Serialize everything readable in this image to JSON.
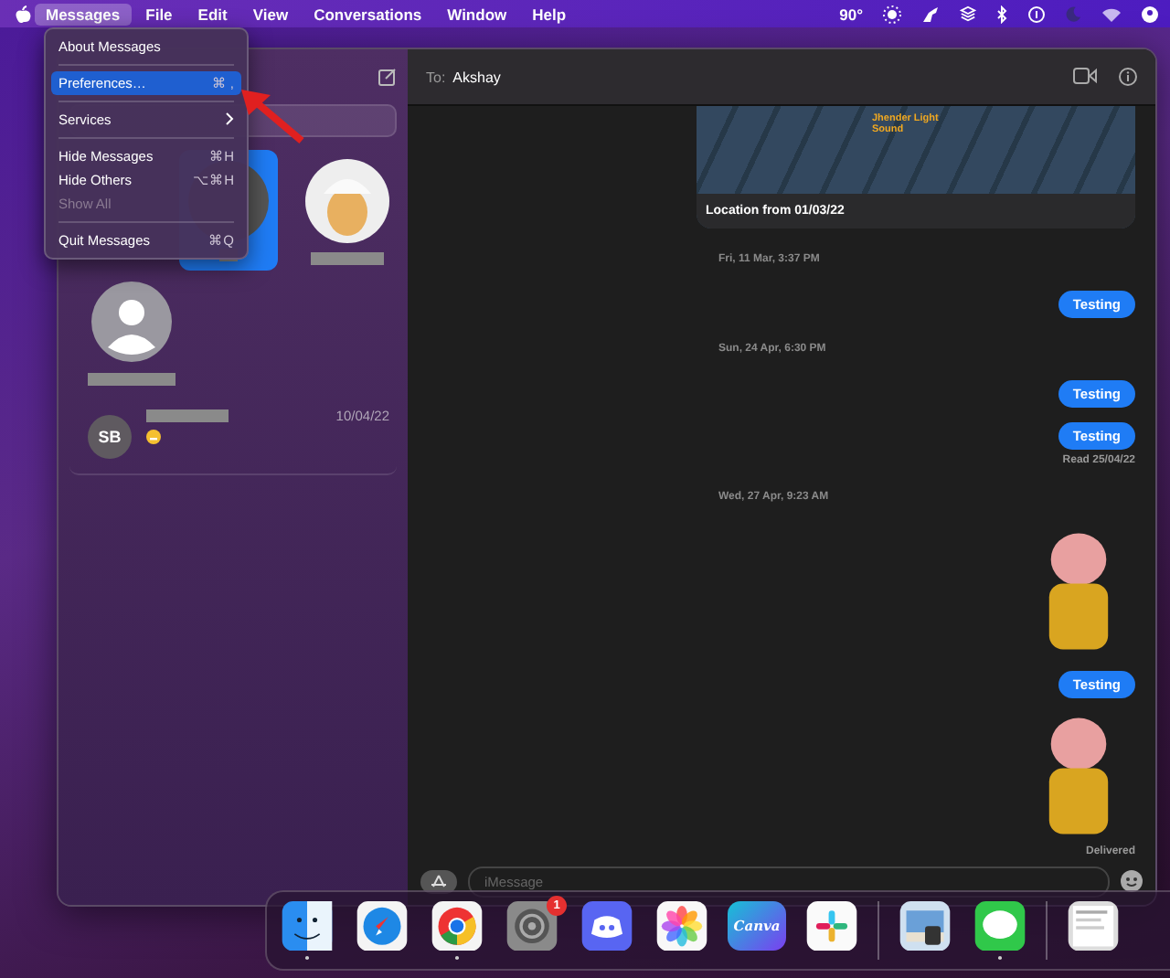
{
  "menu_bar": {
    "items": [
      {
        "label": "Messages",
        "selected": true
      },
      {
        "label": "File",
        "selected": false
      },
      {
        "label": "Edit",
        "selected": false
      },
      {
        "label": "View",
        "selected": false
      },
      {
        "label": "Conversations",
        "selected": false
      },
      {
        "label": "Window",
        "selected": false
      },
      {
        "label": "Help",
        "selected": false
      }
    ],
    "temperature": "90°"
  },
  "menu": {
    "items": [
      {
        "kind": "item",
        "label": "About Messages",
        "selected": false,
        "disabled": false
      },
      {
        "kind": "separator"
      },
      {
        "kind": "item",
        "label": "Preferences…",
        "shortcut": "⌘ ,",
        "selected": true,
        "disabled": false
      },
      {
        "kind": "separator"
      },
      {
        "kind": "submenu",
        "label": "Services",
        "selected": false,
        "disabled": false
      },
      {
        "kind": "separator"
      },
      {
        "kind": "item",
        "label": "Hide Messages",
        "shortcut": "⌘H",
        "selected": false,
        "disabled": false
      },
      {
        "kind": "item",
        "label": "Hide Others",
        "shortcut": "⌥⌘H",
        "selected": false,
        "disabled": false
      },
      {
        "kind": "item",
        "label": "Show All",
        "selected": false,
        "disabled": true
      },
      {
        "kind": "separator"
      },
      {
        "kind": "item",
        "label": "Quit Messages",
        "shortcut": "⌘Q",
        "selected": false,
        "disabled": false
      }
    ]
  },
  "sidebar": {
    "pinned": [
      {
        "kind": "photo",
        "selected": true
      },
      {
        "kind": "memoji",
        "selected": false
      }
    ],
    "contacts": [
      {
        "kind": "avatar"
      }
    ],
    "conversations": [
      {
        "initials": "SB",
        "date": "10/04/22",
        "selected": false
      }
    ]
  },
  "chat": {
    "to_label": "To:",
    "recipient": "Akshay",
    "messages": [
      {
        "kind": "location",
        "caption": "Location from 01/03/22",
        "place": "Jhender Light Sound"
      },
      {
        "kind": "timestamp",
        "text": "Fri, 11 Mar, 3:37 PM"
      },
      {
        "kind": "bubble",
        "text": "Testing"
      },
      {
        "kind": "timestamp",
        "text": "Sun, 24 Apr, 6:30 PM"
      },
      {
        "kind": "bubble",
        "text": "Testing"
      },
      {
        "kind": "bubble",
        "text": "Testing"
      },
      {
        "kind": "receipt",
        "text": "Read 25/04/22"
      },
      {
        "kind": "timestamp",
        "text": "Wed, 27 Apr, 9:23 AM"
      },
      {
        "kind": "sticker"
      },
      {
        "kind": "bubble",
        "text": "Testing"
      },
      {
        "kind": "sticker"
      },
      {
        "kind": "receipt",
        "text": "Delivered"
      }
    ],
    "compose": {
      "placeholder": "iMessage"
    }
  },
  "dock": {
    "apps": [
      {
        "kind": "finder",
        "running": true
      },
      {
        "kind": "safari",
        "running": false
      },
      {
        "kind": "chrome",
        "running": true
      },
      {
        "kind": "settings",
        "running": false,
        "badge": "1"
      },
      {
        "kind": "discord",
        "running": false
      },
      {
        "kind": "photos",
        "running": false
      },
      {
        "kind": "canva",
        "running": false,
        "label": "Canva"
      },
      {
        "kind": "slack",
        "running": false
      },
      {
        "kind": "divider"
      },
      {
        "kind": "preview",
        "running": false
      },
      {
        "kind": "messages",
        "running": true
      },
      {
        "kind": "divider"
      },
      {
        "kind": "window",
        "running": false
      }
    ]
  }
}
